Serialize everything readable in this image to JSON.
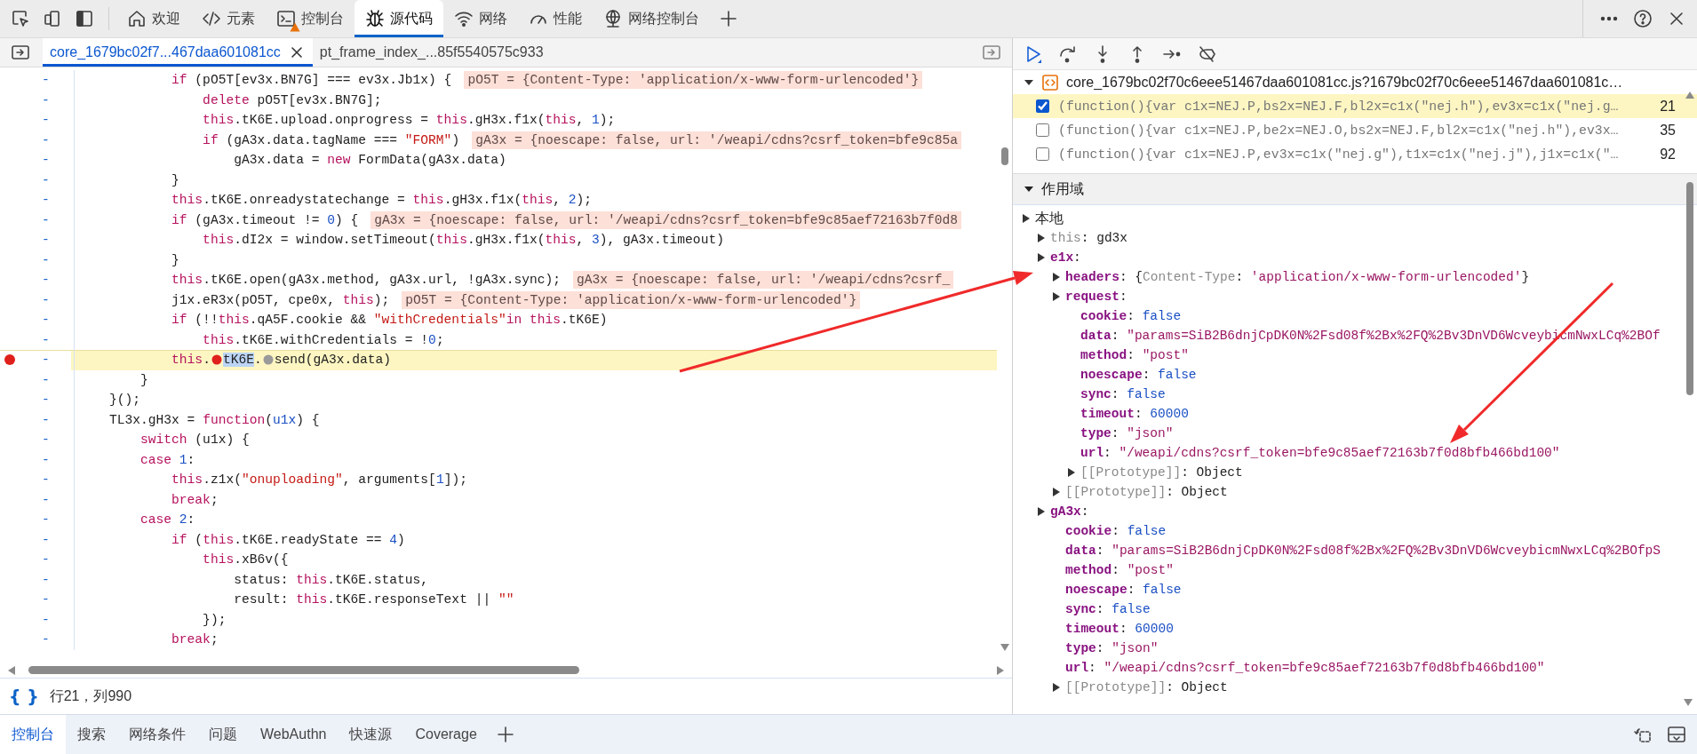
{
  "main_tabs": {
    "items": [
      {
        "label": "欢迎",
        "selected": false,
        "warning": false
      },
      {
        "label": "元素",
        "selected": false,
        "warning": false
      },
      {
        "label": "控制台",
        "selected": false,
        "warning": true
      },
      {
        "label": "源代码",
        "selected": true,
        "warning": false
      },
      {
        "label": "网络",
        "selected": false,
        "warning": false
      },
      {
        "label": "性能",
        "selected": false,
        "warning": false
      },
      {
        "label": "网络控制台",
        "selected": false,
        "warning": false
      }
    ]
  },
  "file_tabs": [
    {
      "label": "core_1679bc02f7...467daa601081cc",
      "selected": true,
      "closable": true
    },
    {
      "label": "pt_frame_index_...85f5540575c933",
      "selected": false,
      "closable": false
    }
  ],
  "code": {
    "lines": [
      {
        "gutter": "-",
        "breakpoint": false,
        "highlighted": false,
        "tokens": [
          {
            "kind": "keyword",
            "text": "            if"
          },
          {
            "kind": "plain",
            "text": " (pO5T[ev3x.BN7G] === ev3x.Jb1x) {"
          }
        ],
        "inline_value": "pO5T = {Content-Type: 'application/x-www-form-urlencoded'}"
      },
      {
        "gutter": "-",
        "breakpoint": false,
        "highlighted": false,
        "tokens": [
          {
            "kind": "keyword",
            "text": "                delete"
          },
          {
            "kind": "plain",
            "text": " pO5T[ev3x.BN7G];"
          }
        ]
      },
      {
        "gutter": "-",
        "breakpoint": false,
        "highlighted": false,
        "tokens": [
          {
            "kind": "keyword",
            "text": "                this"
          },
          {
            "kind": "plain",
            "text": ".tK6E.upload.onprogress = "
          },
          {
            "kind": "keyword",
            "text": "this"
          },
          {
            "kind": "plain",
            "text": ".gH3x.f1x("
          },
          {
            "kind": "keyword",
            "text": "this"
          },
          {
            "kind": "plain",
            "text": ", "
          },
          {
            "kind": "number",
            "text": "1"
          },
          {
            "kind": "plain",
            "text": ");"
          }
        ]
      },
      {
        "gutter": "-",
        "breakpoint": false,
        "highlighted": false,
        "tokens": [
          {
            "kind": "keyword",
            "text": "                if"
          },
          {
            "kind": "plain",
            "text": " (gA3x.data.tagName === "
          },
          {
            "kind": "string",
            "text": "\"FORM\""
          },
          {
            "kind": "plain",
            "text": ")"
          }
        ],
        "inline_value": "gA3x = {noescape: false, url: '/weapi/cdns?csrf_token=bfe9c85a"
      },
      {
        "gutter": "-",
        "breakpoint": false,
        "highlighted": false,
        "tokens": [
          {
            "kind": "plain",
            "text": "                    gA3x.data = "
          },
          {
            "kind": "keyword",
            "text": "new"
          },
          {
            "kind": "plain",
            "text": " FormData(gA3x.data)"
          }
        ]
      },
      {
        "gutter": "-",
        "breakpoint": false,
        "highlighted": false,
        "tokens": [
          {
            "kind": "plain",
            "text": "            }"
          }
        ]
      },
      {
        "gutter": "-",
        "breakpoint": false,
        "highlighted": false,
        "tokens": [
          {
            "kind": "keyword",
            "text": "            this"
          },
          {
            "kind": "plain",
            "text": ".tK6E.onreadystatechange = "
          },
          {
            "kind": "keyword",
            "text": "this"
          },
          {
            "kind": "plain",
            "text": ".gH3x.f1x("
          },
          {
            "kind": "keyword",
            "text": "this"
          },
          {
            "kind": "plain",
            "text": ", "
          },
          {
            "kind": "number",
            "text": "2"
          },
          {
            "kind": "plain",
            "text": ");"
          }
        ]
      },
      {
        "gutter": "-",
        "breakpoint": false,
        "highlighted": false,
        "tokens": [
          {
            "kind": "keyword",
            "text": "            if"
          },
          {
            "kind": "plain",
            "text": " (gA3x.timeout != "
          },
          {
            "kind": "number",
            "text": "0"
          },
          {
            "kind": "plain",
            "text": ") {"
          }
        ],
        "inline_value": "gA3x = {noescape: false, url: '/weapi/cdns?csrf_token=bfe9c85aef72163b7f0d8"
      },
      {
        "gutter": "-",
        "breakpoint": false,
        "highlighted": false,
        "tokens": [
          {
            "kind": "keyword",
            "text": "                this"
          },
          {
            "kind": "plain",
            "text": ".dI2x = window.setTimeout("
          },
          {
            "kind": "keyword",
            "text": "this"
          },
          {
            "kind": "plain",
            "text": ".gH3x.f1x("
          },
          {
            "kind": "keyword",
            "text": "this"
          },
          {
            "kind": "plain",
            "text": ", "
          },
          {
            "kind": "number",
            "text": "3"
          },
          {
            "kind": "plain",
            "text": "), gA3x.timeout)"
          }
        ]
      },
      {
        "gutter": "-",
        "breakpoint": false,
        "highlighted": false,
        "tokens": [
          {
            "kind": "plain",
            "text": "            }"
          }
        ]
      },
      {
        "gutter": "-",
        "breakpoint": false,
        "highlighted": false,
        "tokens": [
          {
            "kind": "keyword",
            "text": "            this"
          },
          {
            "kind": "plain",
            "text": ".tK6E.open(gA3x.method, gA3x.url, !gA3x.sync);"
          }
        ],
        "inline_value": "gA3x = {noescape: false, url: '/weapi/cdns?csrf_"
      },
      {
        "gutter": "-",
        "breakpoint": false,
        "highlighted": false,
        "tokens": [
          {
            "kind": "plain",
            "text": "            j1x.eR3x(pO5T, cpe0x, "
          },
          {
            "kind": "keyword",
            "text": "this"
          },
          {
            "kind": "plain",
            "text": ");"
          }
        ],
        "inline_value": "pO5T = {Content-Type: 'application/x-www-form-urlencoded'}"
      },
      {
        "gutter": "-",
        "breakpoint": false,
        "highlighted": false,
        "tokens": [
          {
            "kind": "keyword",
            "text": "            if"
          },
          {
            "kind": "plain",
            "text": " (!!"
          },
          {
            "kind": "keyword",
            "text": "this"
          },
          {
            "kind": "plain",
            "text": ".qA5F.cookie && "
          },
          {
            "kind": "string",
            "text": "\"withCredentials\""
          },
          {
            "kind": "keyword",
            "text": "in"
          },
          {
            "kind": "keyword",
            "text": " this"
          },
          {
            "kind": "plain",
            "text": ".tK6E)"
          }
        ]
      },
      {
        "gutter": "-",
        "breakpoint": false,
        "highlighted": false,
        "tokens": [
          {
            "kind": "keyword",
            "text": "                this"
          },
          {
            "kind": "plain",
            "text": ".tK6E.withCredentials = !"
          },
          {
            "kind": "number",
            "text": "0"
          },
          {
            "kind": "plain",
            "text": ";"
          }
        ]
      },
      {
        "gutter": "-",
        "breakpoint": true,
        "highlighted": true,
        "tokens": [
          {
            "kind": "keyword",
            "text": "            this"
          },
          {
            "kind": "plain",
            "text": "."
          },
          {
            "kind": "marker",
            "active": true
          },
          {
            "kind": "selection",
            "text": "tK6E"
          },
          {
            "kind": "plain",
            "text": "."
          },
          {
            "kind": "marker",
            "active": false
          },
          {
            "kind": "plain",
            "text": "send(gA3x.data)"
          }
        ]
      },
      {
        "gutter": "-",
        "breakpoint": false,
        "highlighted": false,
        "tokens": [
          {
            "kind": "plain",
            "text": "        }"
          }
        ]
      },
      {
        "gutter": "-",
        "breakpoint": false,
        "highlighted": false,
        "tokens": [
          {
            "kind": "plain",
            "text": "    }();"
          }
        ]
      },
      {
        "gutter": "-",
        "breakpoint": false,
        "highlighted": false,
        "tokens": [
          {
            "kind": "plain",
            "text": "    TL3x.gH3x = "
          },
          {
            "kind": "keyword",
            "text": "function"
          },
          {
            "kind": "plain",
            "text": "("
          },
          {
            "kind": "parameter",
            "text": "u1x"
          },
          {
            "kind": "plain",
            "text": ") {"
          }
        ]
      },
      {
        "gutter": "-",
        "breakpoint": false,
        "highlighted": false,
        "tokens": [
          {
            "kind": "keyword",
            "text": "        switch"
          },
          {
            "kind": "plain",
            "text": " (u1x) {"
          }
        ]
      },
      {
        "gutter": "-",
        "breakpoint": false,
        "highlighted": false,
        "tokens": [
          {
            "kind": "keyword",
            "text": "        case"
          },
          {
            "kind": "number",
            "text": " 1"
          },
          {
            "kind": "plain",
            "text": ":"
          }
        ]
      },
      {
        "gutter": "-",
        "breakpoint": false,
        "highlighted": false,
        "tokens": [
          {
            "kind": "keyword",
            "text": "            this"
          },
          {
            "kind": "plain",
            "text": ".z1x("
          },
          {
            "kind": "string",
            "text": "\"onuploading\""
          },
          {
            "kind": "plain",
            "text": ", arguments["
          },
          {
            "kind": "number",
            "text": "1"
          },
          {
            "kind": "plain",
            "text": "]);"
          }
        ]
      },
      {
        "gutter": "-",
        "breakpoint": false,
        "highlighted": false,
        "tokens": [
          {
            "kind": "keyword",
            "text": "            break"
          },
          {
            "kind": "plain",
            "text": ";"
          }
        ]
      },
      {
        "gutter": "-",
        "breakpoint": false,
        "highlighted": false,
        "tokens": [
          {
            "kind": "keyword",
            "text": "        case"
          },
          {
            "kind": "number",
            "text": " 2"
          },
          {
            "kind": "plain",
            "text": ":"
          }
        ]
      },
      {
        "gutter": "-",
        "breakpoint": false,
        "highlighted": false,
        "tokens": [
          {
            "kind": "keyword",
            "text": "            if"
          },
          {
            "kind": "plain",
            "text": " ("
          },
          {
            "kind": "keyword",
            "text": "this"
          },
          {
            "kind": "plain",
            "text": ".tK6E.readyState == "
          },
          {
            "kind": "number",
            "text": "4"
          },
          {
            "kind": "plain",
            "text": ")"
          }
        ]
      },
      {
        "gutter": "-",
        "breakpoint": false,
        "highlighted": false,
        "tokens": [
          {
            "kind": "keyword",
            "text": "                this"
          },
          {
            "kind": "plain",
            "text": ".xB6v({"
          }
        ]
      },
      {
        "gutter": "-",
        "breakpoint": false,
        "highlighted": false,
        "tokens": [
          {
            "kind": "plain",
            "text": "                    status: "
          },
          {
            "kind": "keyword",
            "text": "this"
          },
          {
            "kind": "plain",
            "text": ".tK6E.status,"
          }
        ]
      },
      {
        "gutter": "-",
        "breakpoint": false,
        "highlighted": false,
        "tokens": [
          {
            "kind": "plain",
            "text": "                    result: "
          },
          {
            "kind": "keyword",
            "text": "this"
          },
          {
            "kind": "plain",
            "text": ".tK6E.responseText || "
          },
          {
            "kind": "string",
            "text": "\"\""
          }
        ]
      },
      {
        "gutter": "-",
        "breakpoint": false,
        "highlighted": false,
        "tokens": [
          {
            "kind": "plain",
            "text": "                });"
          }
        ]
      },
      {
        "gutter": "-",
        "breakpoint": false,
        "highlighted": false,
        "tokens": [
          {
            "kind": "keyword",
            "text": "            break"
          },
          {
            "kind": "plain",
            "text": ";"
          }
        ]
      }
    ]
  },
  "status": {
    "format": "{ }",
    "position": "行21，列990"
  },
  "breakpoints": {
    "file": "core_1679bc02f70c6eee51467daa601081cc.js?1679bc02f70c6eee51467daa601081c…",
    "expanded": true,
    "items": [
      {
        "checked": true,
        "selected": true,
        "code": "(function(){var c1x=NEJ.P,bs2x=NEJ.F,bl2x=c1x(\"nej.h\"),ev3x=c1x(\"nej.g…",
        "line": "21"
      },
      {
        "checked": false,
        "selected": false,
        "code": "(function(){var c1x=NEJ.P,be2x=NEJ.O,bs2x=NEJ.F,bl2x=c1x(\"nej.h\"),ev3x…",
        "line": "35"
      },
      {
        "checked": false,
        "selected": false,
        "code": "(function(){var c1x=NEJ.P,ev3x=c1x(\"nej.g\"),t1x=c1x(\"nej.j\"),j1x=c1x(\"…",
        "line": "92"
      }
    ]
  },
  "scope": {
    "title": "作用域",
    "expanded": true,
    "tree": [
      {
        "tokens": [
          {
            "kind": "plain",
            "text": "本地"
          }
        ],
        "expanded": false,
        "children": [
          {
            "tokens": [
              {
                "kind": "internal",
                "text": "this"
              },
              {
                "kind": "plain",
                "text": ": gd3x"
              }
            ],
            "expanded": false
          },
          {
            "tokens": [
              {
                "kind": "property",
                "text": "e1x"
              },
              {
                "kind": "plain",
                "text": ":"
              }
            ],
            "expanded": false,
            "children": [
              {
                "tokens": [
                  {
                    "kind": "property",
                    "text": "headers"
                  },
                  {
                    "kind": "plain",
                    "text": ": {"
                  },
                  {
                    "kind": "dim",
                    "text": "Content-Type"
                  },
                  {
                    "kind": "plain",
                    "text": ": "
                  },
                  {
                    "kind": "string",
                    "text": "'application/x-www-form-urlencoded'"
                  },
                  {
                    "kind": "plain",
                    "text": "}"
                  }
                ],
                "expanded": false
              },
              {
                "tokens": [
                  {
                    "kind": "property",
                    "text": "request"
                  },
                  {
                    "kind": "plain",
                    "text": ":"
                  }
                ],
                "expanded": false,
                "children": [
                  {
                    "tokens": [
                      {
                        "kind": "property",
                        "text": "cookie"
                      },
                      {
                        "kind": "plain",
                        "text": ": "
                      },
                      {
                        "kind": "literal",
                        "text": "false"
                      }
                    ]
                  },
                  {
                    "tokens": [
                      {
                        "kind": "property",
                        "text": "data"
                      },
                      {
                        "kind": "plain",
                        "text": ": "
                      },
                      {
                        "kind": "string",
                        "text": "\"params=SiB2B6dnjCpDK0N%2Fsd08f%2Bx%2FQ%2Bv3DnVD6WcveybicmNwxLCq%2BOf"
                      }
                    ]
                  },
                  {
                    "tokens": [
                      {
                        "kind": "property",
                        "text": "method"
                      },
                      {
                        "kind": "plain",
                        "text": ": "
                      },
                      {
                        "kind": "string",
                        "text": "\"post\""
                      }
                    ]
                  },
                  {
                    "tokens": [
                      {
                        "kind": "property",
                        "text": "noescape"
                      },
                      {
                        "kind": "plain",
                        "text": ": "
                      },
                      {
                        "kind": "literal",
                        "text": "false"
                      }
                    ]
                  },
                  {
                    "tokens": [
                      {
                        "kind": "property",
                        "text": "sync"
                      },
                      {
                        "kind": "plain",
                        "text": ": "
                      },
                      {
                        "kind": "literal",
                        "text": "false"
                      }
                    ]
                  },
                  {
                    "tokens": [
                      {
                        "kind": "property",
                        "text": "timeout"
                      },
                      {
                        "kind": "plain",
                        "text": ": "
                      },
                      {
                        "kind": "literal",
                        "text": "60000"
                      }
                    ]
                  },
                  {
                    "tokens": [
                      {
                        "kind": "property",
                        "text": "type"
                      },
                      {
                        "kind": "plain",
                        "text": ": "
                      },
                      {
                        "kind": "string",
                        "text": "\"json\""
                      }
                    ]
                  },
                  {
                    "tokens": [
                      {
                        "kind": "property",
                        "text": "url"
                      },
                      {
                        "kind": "plain",
                        "text": ": "
                      },
                      {
                        "kind": "string",
                        "text": "\"/weapi/cdns?csrf_token=bfe9c85aef72163b7f0d8bfb466bd100\""
                      }
                    ]
                  },
                  {
                    "tokens": [
                      {
                        "kind": "internal",
                        "text": "[[Prototype]]"
                      },
                      {
                        "kind": "plain",
                        "text": ": Object"
                      }
                    ],
                    "expanded": false
                  }
                ]
              },
              {
                "tokens": [
                  {
                    "kind": "internal",
                    "text": "[[Prototype]]"
                  },
                  {
                    "kind": "plain",
                    "text": ": Object"
                  }
                ],
                "expanded": false
              }
            ]
          },
          {
            "tokens": [
              {
                "kind": "property",
                "text": "gA3x"
              },
              {
                "kind": "plain",
                "text": ":"
              }
            ],
            "expanded": false,
            "children": [
              {
                "tokens": [
                  {
                    "kind": "property",
                    "text": "cookie"
                  },
                  {
                    "kind": "plain",
                    "text": ": "
                  },
                  {
                    "kind": "literal",
                    "text": "false"
                  }
                ]
              },
              {
                "tokens": [
                  {
                    "kind": "property",
                    "text": "data"
                  },
                  {
                    "kind": "plain",
                    "text": ": "
                  },
                  {
                    "kind": "string",
                    "text": "\"params=SiB2B6dnjCpDK0N%2Fsd08f%2Bx%2FQ%2Bv3DnVD6WcveybicmNwxLCq%2BOfpS"
                  }
                ]
              },
              {
                "tokens": [
                  {
                    "kind": "property",
                    "text": "method"
                  },
                  {
                    "kind": "plain",
                    "text": ": "
                  },
                  {
                    "kind": "string",
                    "text": "\"post\""
                  }
                ]
              },
              {
                "tokens": [
                  {
                    "kind": "property",
                    "text": "noescape"
                  },
                  {
                    "kind": "plain",
                    "text": ": "
                  },
                  {
                    "kind": "literal",
                    "text": "false"
                  }
                ]
              },
              {
                "tokens": [
                  {
                    "kind": "property",
                    "text": "sync"
                  },
                  {
                    "kind": "plain",
                    "text": ": "
                  },
                  {
                    "kind": "literal",
                    "text": "false"
                  }
                ]
              },
              {
                "tokens": [
                  {
                    "kind": "property",
                    "text": "timeout"
                  },
                  {
                    "kind": "plain",
                    "text": ": "
                  },
                  {
                    "kind": "literal",
                    "text": "60000"
                  }
                ]
              },
              {
                "tokens": [
                  {
                    "kind": "property",
                    "text": "type"
                  },
                  {
                    "kind": "plain",
                    "text": ": "
                  },
                  {
                    "kind": "string",
                    "text": "\"json\""
                  }
                ]
              },
              {
                "tokens": [
                  {
                    "kind": "property",
                    "text": "url"
                  },
                  {
                    "kind": "plain",
                    "text": ": "
                  },
                  {
                    "kind": "string",
                    "text": "\"/weapi/cdns?csrf_token=bfe9c85aef72163b7f0d8bfb466bd100\""
                  }
                ]
              },
              {
                "tokens": [
                  {
                    "kind": "internal",
                    "text": "[[Prototype]]"
                  },
                  {
                    "kind": "plain",
                    "text": ": Object"
                  }
                ],
                "expanded": false
              }
            ]
          }
        ]
      }
    ]
  },
  "drawer_tabs": [
    {
      "label": "控制台",
      "selected": true
    },
    {
      "label": "搜索",
      "selected": false
    },
    {
      "label": "网络条件",
      "selected": false
    },
    {
      "label": "问题",
      "selected": false
    },
    {
      "label": "WebAuthn",
      "selected": false
    },
    {
      "label": "快速源",
      "selected": false
    },
    {
      "label": "Coverage",
      "selected": false
    }
  ]
}
